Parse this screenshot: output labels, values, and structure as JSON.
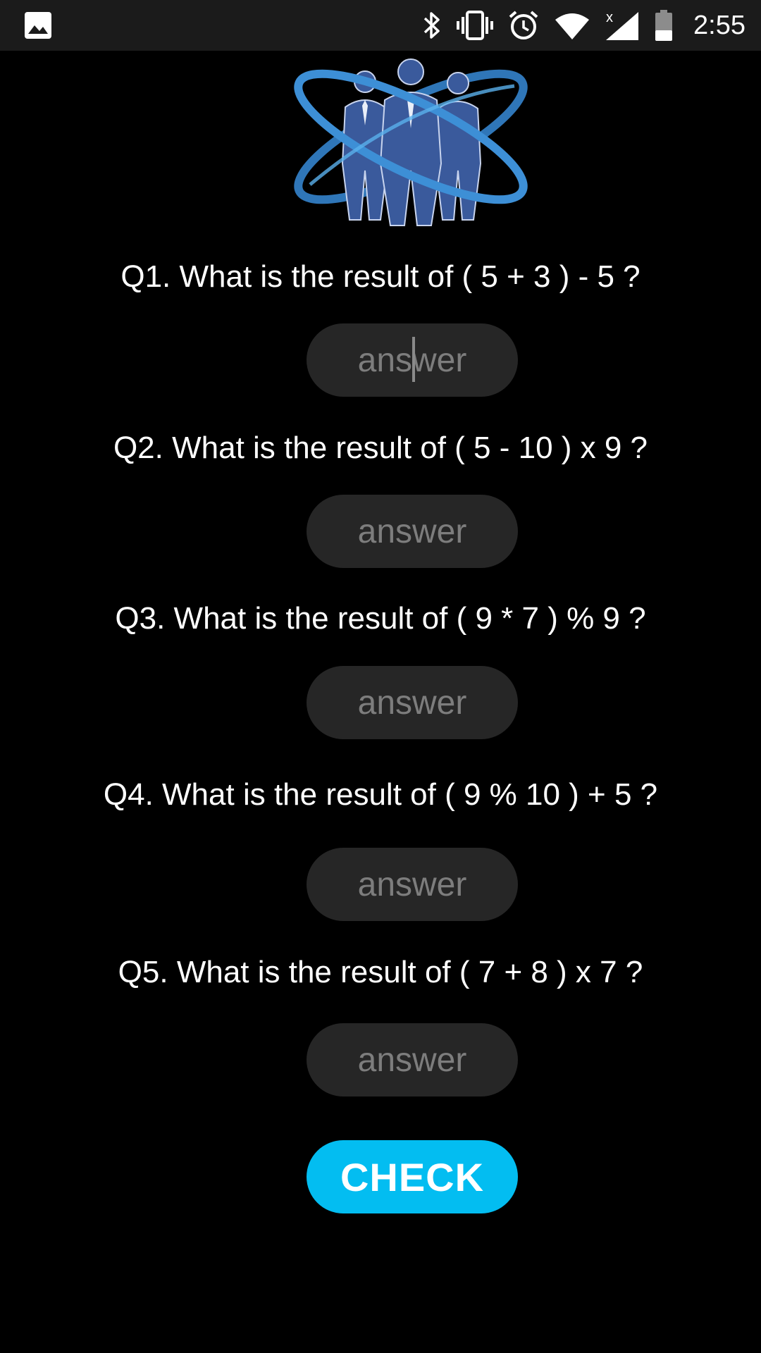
{
  "status_bar": {
    "time": "2:55",
    "icons": [
      "image-icon",
      "bluetooth-icon",
      "vibrate-icon",
      "alarm-icon",
      "wifi-icon",
      "signal-icon",
      "battery-icon"
    ]
  },
  "logo": {
    "icon": "business-people-orbit-logo",
    "colors": {
      "ring": "#3d8fd6",
      "figures": "#3a5a9c"
    }
  },
  "questions": [
    {
      "label": "Q1. What is the result of ( 5 + 3 ) - 5 ?",
      "answer_value": "",
      "answer_placeholder": "answer"
    },
    {
      "label": "Q2. What is the result of ( 5 - 10 ) x 9 ?",
      "answer_value": "",
      "answer_placeholder": "answer"
    },
    {
      "label": "Q3. What is the result of ( 9 * 7 ) % 9 ?",
      "answer_value": "",
      "answer_placeholder": "answer"
    },
    {
      "label": "Q4. What is the result of ( 9 % 10 ) + 5 ?",
      "answer_value": "",
      "answer_placeholder": "answer"
    },
    {
      "label": "Q5. What is the result of ( 7 + 8 ) x 7 ?",
      "answer_value": "",
      "answer_placeholder": "answer"
    }
  ],
  "check_button": {
    "label": "CHECK",
    "color": "#03bdf1"
  },
  "colors": {
    "background": "#000000",
    "field_background": "#262626",
    "placeholder": "#7d7d7d"
  }
}
